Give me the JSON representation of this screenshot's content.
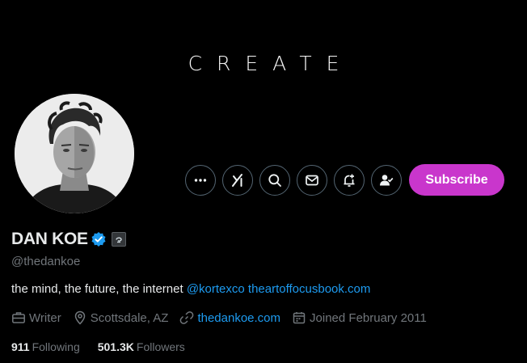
{
  "banner": {
    "text": "CREATE"
  },
  "profile": {
    "display_name": "DAN KOE",
    "handle": "@thedankoe",
    "bio_text": "the mind, the future, the internet",
    "bio_mention": "@kortexco",
    "bio_link": "theartoffocusbook.com",
    "occupation": "Writer",
    "location": "Scottsdale, AZ",
    "website": "thedankoe.com",
    "joined": "Joined February 2011",
    "following_count": "911",
    "following_label": "Following",
    "followers_count": "501.3K",
    "followers_label": "Followers"
  },
  "actions": {
    "more_icon": "more-icon",
    "grok_icon": "grok-icon",
    "search_icon": "search-icon",
    "message_icon": "mail-icon",
    "notify_icon": "bell-plus-icon",
    "following_icon": "person-check-icon",
    "subscribe_label": "Subscribe"
  },
  "colors": {
    "accent_link": "#1d9bf0",
    "subscribe": "#c936cc",
    "verified": "#1d9bf0",
    "muted": "#71767b",
    "text": "#e7e9ea",
    "background": "#000000"
  }
}
